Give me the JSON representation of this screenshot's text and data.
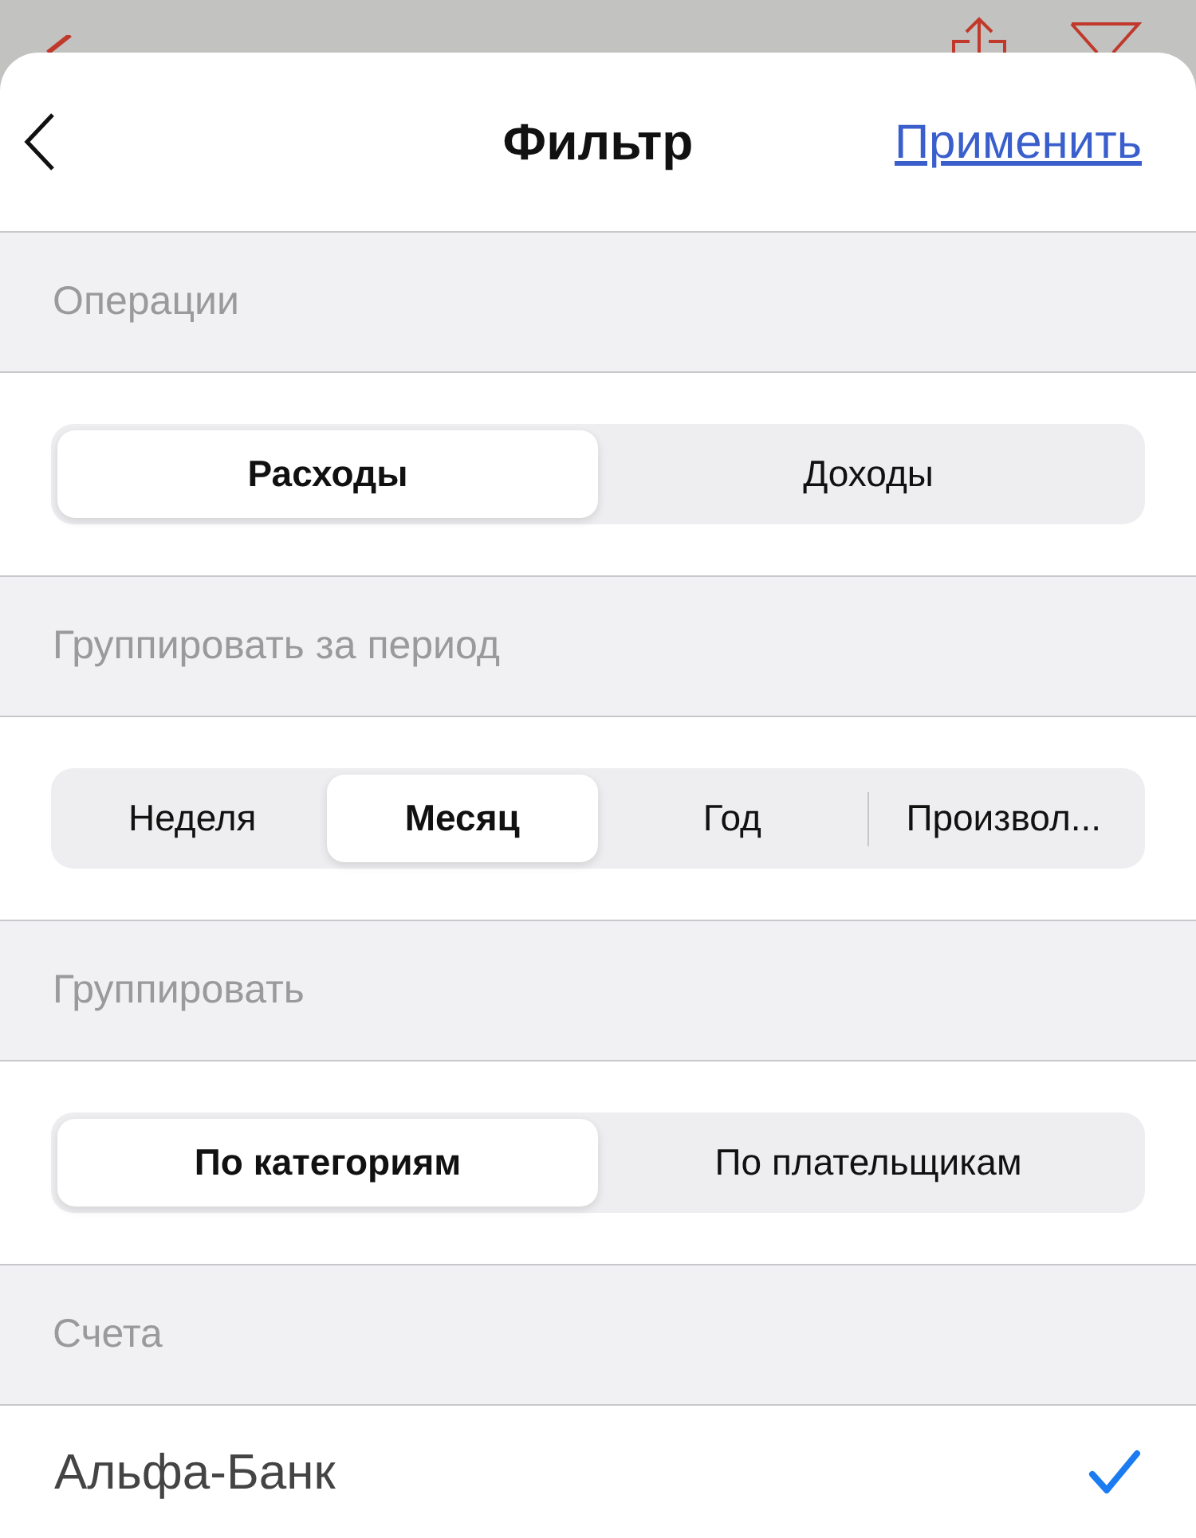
{
  "sheet": {
    "title": "Фильтр",
    "action": "Применить"
  },
  "sections": [
    {
      "header": "Операции",
      "kind": "segmented",
      "options": [
        {
          "label": "Расходы",
          "selected": true
        },
        {
          "label": "Доходы",
          "selected": false
        }
      ]
    },
    {
      "header": "Группировать за период",
      "kind": "segmented",
      "options": [
        {
          "label": "Неделя",
          "selected": false
        },
        {
          "label": "Месяц",
          "selected": true
        },
        {
          "label": "Год",
          "selected": false
        },
        {
          "label": "Произвол...",
          "selected": false
        }
      ]
    },
    {
      "header": "Группировать",
      "kind": "segmented",
      "options": [
        {
          "label": "По категориям",
          "selected": true
        },
        {
          "label": "По плательщикам",
          "selected": false
        }
      ]
    },
    {
      "header": "Счета",
      "kind": "checklist",
      "items": [
        {
          "label": "Альфа-Банк",
          "checked": true
        }
      ]
    }
  ]
}
